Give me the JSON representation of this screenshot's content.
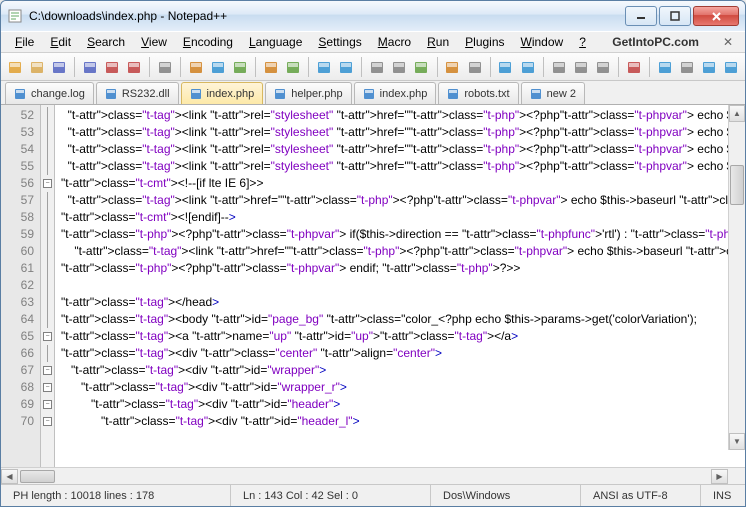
{
  "window": {
    "title": "C:\\downloads\\index.php - Notepad++"
  },
  "brand": "GetIntoPC.com",
  "menu": [
    "File",
    "Edit",
    "Search",
    "View",
    "Encoding",
    "Language",
    "Settings",
    "Macro",
    "Run",
    "Plugins",
    "Window",
    "?"
  ],
  "toolbar_icons": [
    "new",
    "open",
    "save",
    "save-all",
    "close",
    "close-all",
    "print",
    "cut",
    "copy",
    "paste",
    "undo",
    "redo",
    "find",
    "replace",
    "zoom-in",
    "zoom-out",
    "sync",
    "word-wrap",
    "show-all",
    "indent",
    "outdent",
    "fold",
    "unfold",
    "hide",
    "record",
    "play",
    "playback",
    "next",
    "speed"
  ],
  "tabs": [
    {
      "label": "change.log",
      "active": false
    },
    {
      "label": "RS232.dll",
      "active": false
    },
    {
      "label": "index.php",
      "active": true
    },
    {
      "label": "helper.php",
      "active": false
    },
    {
      "label": "index.php",
      "active": false
    },
    {
      "label": "robots.txt",
      "active": false
    },
    {
      "label": "new  2",
      "active": false
    }
  ],
  "first_line": 52,
  "code_lines": [
    "  <link rel=\"stylesheet\" href=\"<?php echo $this->baseurl ?>/templates/system/css/g",
    "  <link rel=\"stylesheet\" href=\"<?php echo $this->baseurl ?>/templates/rhuk_milkywa",
    "  <link rel=\"stylesheet\" href=\"<?php echo $this->baseurl ?>/templates/rhuk_milkywa",
    "  <link rel=\"stylesheet\" href=\"<?php echo $this->baseurl ?>/templates/rhuk_milkywa",
    "<!--[if lte IE 6]>",
    "  <link href=\"<?php echo $this->baseurl ?>/templates/<?php echo $this->template ?>",
    "<![endif]-->",
    "<?php if($this->direction == 'rtl') : ?>",
    "    <link href=\"<?php echo $this->baseurl ?>/templates/rhuk_milkyway/css/templat",
    "<?php endif; ?>",
    "",
    "</head>",
    "<body id=\"page_bg\" class=\"color_<?php echo $this->params->get('colorVariation');",
    "<a name=\"up\" id=\"up\"></a>",
    "<div class=\"center\" align=\"center\">",
    "   <div id=\"wrapper\">",
    "      <div id=\"wrapper_r\">",
    "         <div id=\"header\">",
    "            <div id=\"header_l\">"
  ],
  "fold": [
    "|",
    "|",
    "|",
    "|",
    "-",
    "|",
    "|",
    "|",
    "|",
    "|",
    "|",
    "|",
    "|",
    "-",
    "|",
    "-",
    "-",
    "-",
    "-"
  ],
  "status": {
    "left": "PH  length : 10018     lines : 178",
    "pos": "Ln : 143   Col : 42   Sel : 0",
    "eol": "Dos\\Windows",
    "enc": "ANSI as UTF-8",
    "mode": "INS"
  },
  "toolbar_colors": [
    "#e0a030",
    "#d8a850",
    "#5060c0",
    "#5060c0",
    "#c04040",
    "#c04040",
    "#808080",
    "#d08020",
    "#3090d0",
    "#60a040",
    "#d08020",
    "#60a040",
    "#3090d0",
    "#3090d0",
    "#808080",
    "#808080",
    "#60a040",
    "#d08020",
    "#808080",
    "#3090d0",
    "#3090d0",
    "#808080",
    "#808080",
    "#808080",
    "#c04040",
    "#3090d0",
    "#808080",
    "#3090d0",
    "#3090d0"
  ]
}
